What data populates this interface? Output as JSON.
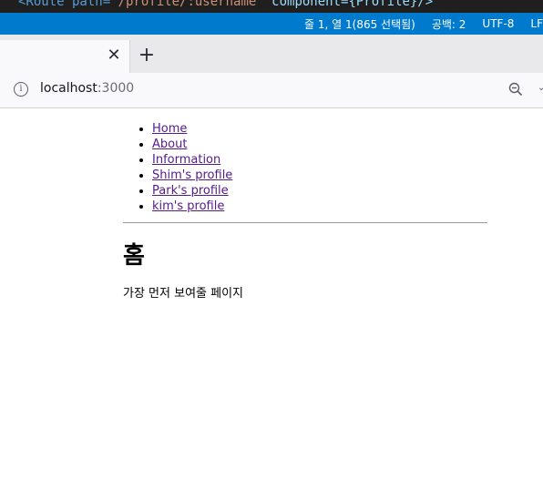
{
  "editor": {
    "code_line_prefix": "<Route path=",
    "code_line_path": "\"/profile/:username\"",
    "code_line_suffix": " component={Profile}/>"
  },
  "statusbar": {
    "position": "줄 1, 열 1(865 선택됨)",
    "spaces": "공백: 2",
    "encoding": "UTF-8",
    "eol": "LF"
  },
  "browser": {
    "tab_close_icon": "close-icon",
    "new_tab_icon": "plus-icon",
    "url_host": "localhost",
    "url_port": ":3000"
  },
  "page": {
    "links": [
      {
        "label": "Home"
      },
      {
        "label": "About"
      },
      {
        "label": "Information"
      },
      {
        "label": "Shim's profile"
      },
      {
        "label": "Park's profile"
      },
      {
        "label": "kim's profile"
      }
    ],
    "heading": "홈",
    "description": "가장 먼저 보여줄 페이지"
  },
  "colors": {
    "statusbar_bg": "#007acc",
    "visited_link": "#551a8b"
  }
}
